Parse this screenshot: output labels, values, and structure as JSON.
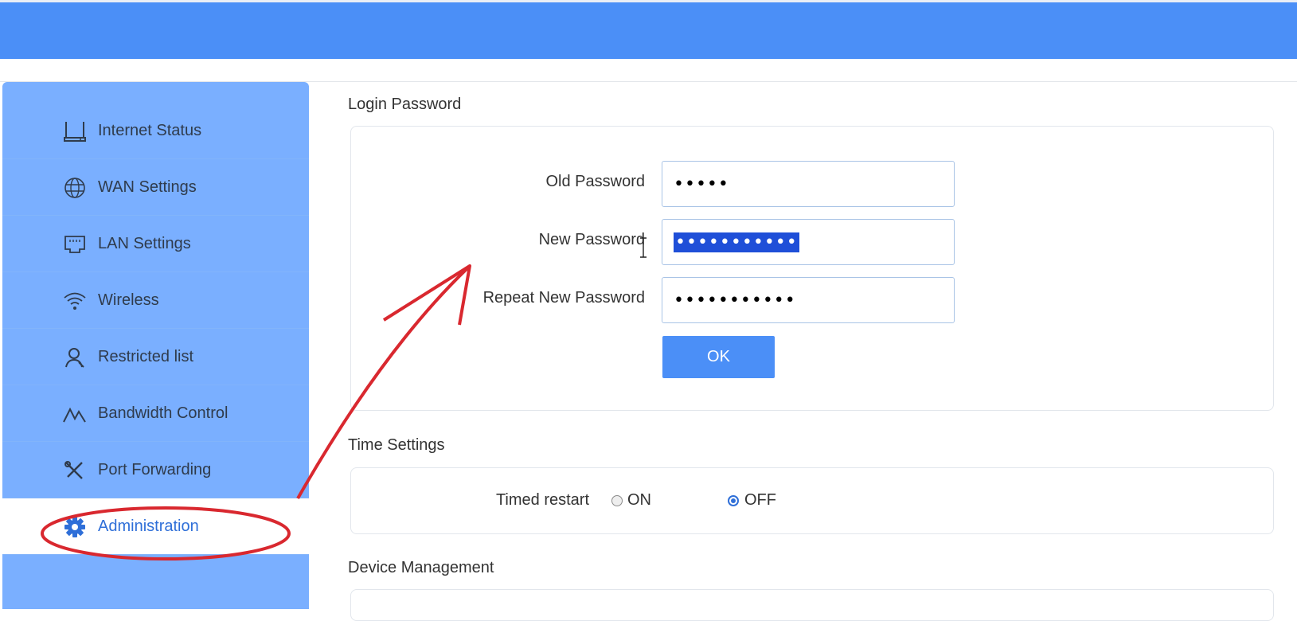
{
  "sidebar": {
    "items": [
      {
        "label": "Internet Status",
        "icon": "router-icon"
      },
      {
        "label": "WAN Settings",
        "icon": "globe-icon"
      },
      {
        "label": "LAN Settings",
        "icon": "ethernet-port-icon"
      },
      {
        "label": "Wireless",
        "icon": "wifi-icon"
      },
      {
        "label": "Restricted list",
        "icon": "user-icon"
      },
      {
        "label": "Bandwidth Control",
        "icon": "bandwidth-icon"
      },
      {
        "label": "Port Forwarding",
        "icon": "tools-icon"
      },
      {
        "label": "Administration",
        "icon": "gear-icon",
        "active": true
      }
    ]
  },
  "login_password": {
    "title": "Login Password",
    "old_label": "Old Password",
    "old_value": "•••••",
    "new_label": "New Password",
    "new_value": "•••••••••••",
    "repeat_label": "Repeat New Password",
    "repeat_value": "•••••••••••",
    "ok_label": "OK"
  },
  "time_settings": {
    "title": "Time Settings",
    "timed_restart_label": "Timed restart",
    "on_label": "ON",
    "off_label": "OFF",
    "selected": "OFF"
  },
  "device_management": {
    "title": "Device Management"
  },
  "colors": {
    "header": "#4b8ff7",
    "sidebar": "#7aafff",
    "accent": "#2f6fd8",
    "annotation": "#d9282f"
  }
}
